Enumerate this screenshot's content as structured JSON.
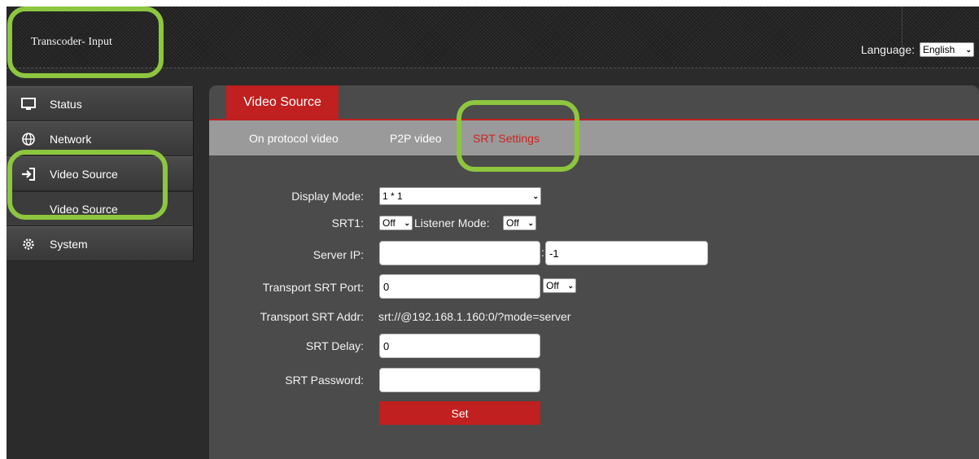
{
  "header": {
    "app_title": "Transcoder- Input",
    "language_label": "Language:",
    "language_value": "English"
  },
  "sidebar": {
    "items": [
      {
        "label": "Status",
        "icon": "monitor-icon"
      },
      {
        "label": "Network",
        "icon": "globe-icon"
      },
      {
        "label": "Video Source",
        "icon": "sign-in-arrow-icon"
      },
      {
        "label": "Video Source",
        "icon": null
      },
      {
        "label": "System",
        "icon": "gear-icon"
      }
    ]
  },
  "main": {
    "tab": "Video Source",
    "subtabs": [
      {
        "label": "On protocol video",
        "active": false
      },
      {
        "label": "P2P video",
        "active": false
      },
      {
        "label": "SRT Settings",
        "active": true
      }
    ]
  },
  "form": {
    "display_mode_label": "Display Mode:",
    "display_mode_value": "1 * 1",
    "srt1_label": "SRT1:",
    "srt1_value": "Off",
    "listener_mode_label": "Listener Mode:",
    "listener_mode_value": "Off",
    "server_ip_label": "Server IP:",
    "server_ip_value": "",
    "server_ip_separator": ":",
    "server_port_value": "-1",
    "transport_port_label": "Transport SRT Port:",
    "transport_port_value": "0",
    "transport_port_toggle": "Off",
    "transport_addr_label": "Transport SRT Addr:",
    "transport_addr_value": "srt://@192.168.1.160:0/?mode=server",
    "srt_delay_label": "SRT Delay:",
    "srt_delay_value": "0",
    "srt_password_label": "SRT Password:",
    "srt_password_value": "",
    "set_label": "Set"
  },
  "colors": {
    "accent_red": "#c0201f",
    "highlight_green": "#8dc63f",
    "active_subtab_text": "#d0231f"
  }
}
